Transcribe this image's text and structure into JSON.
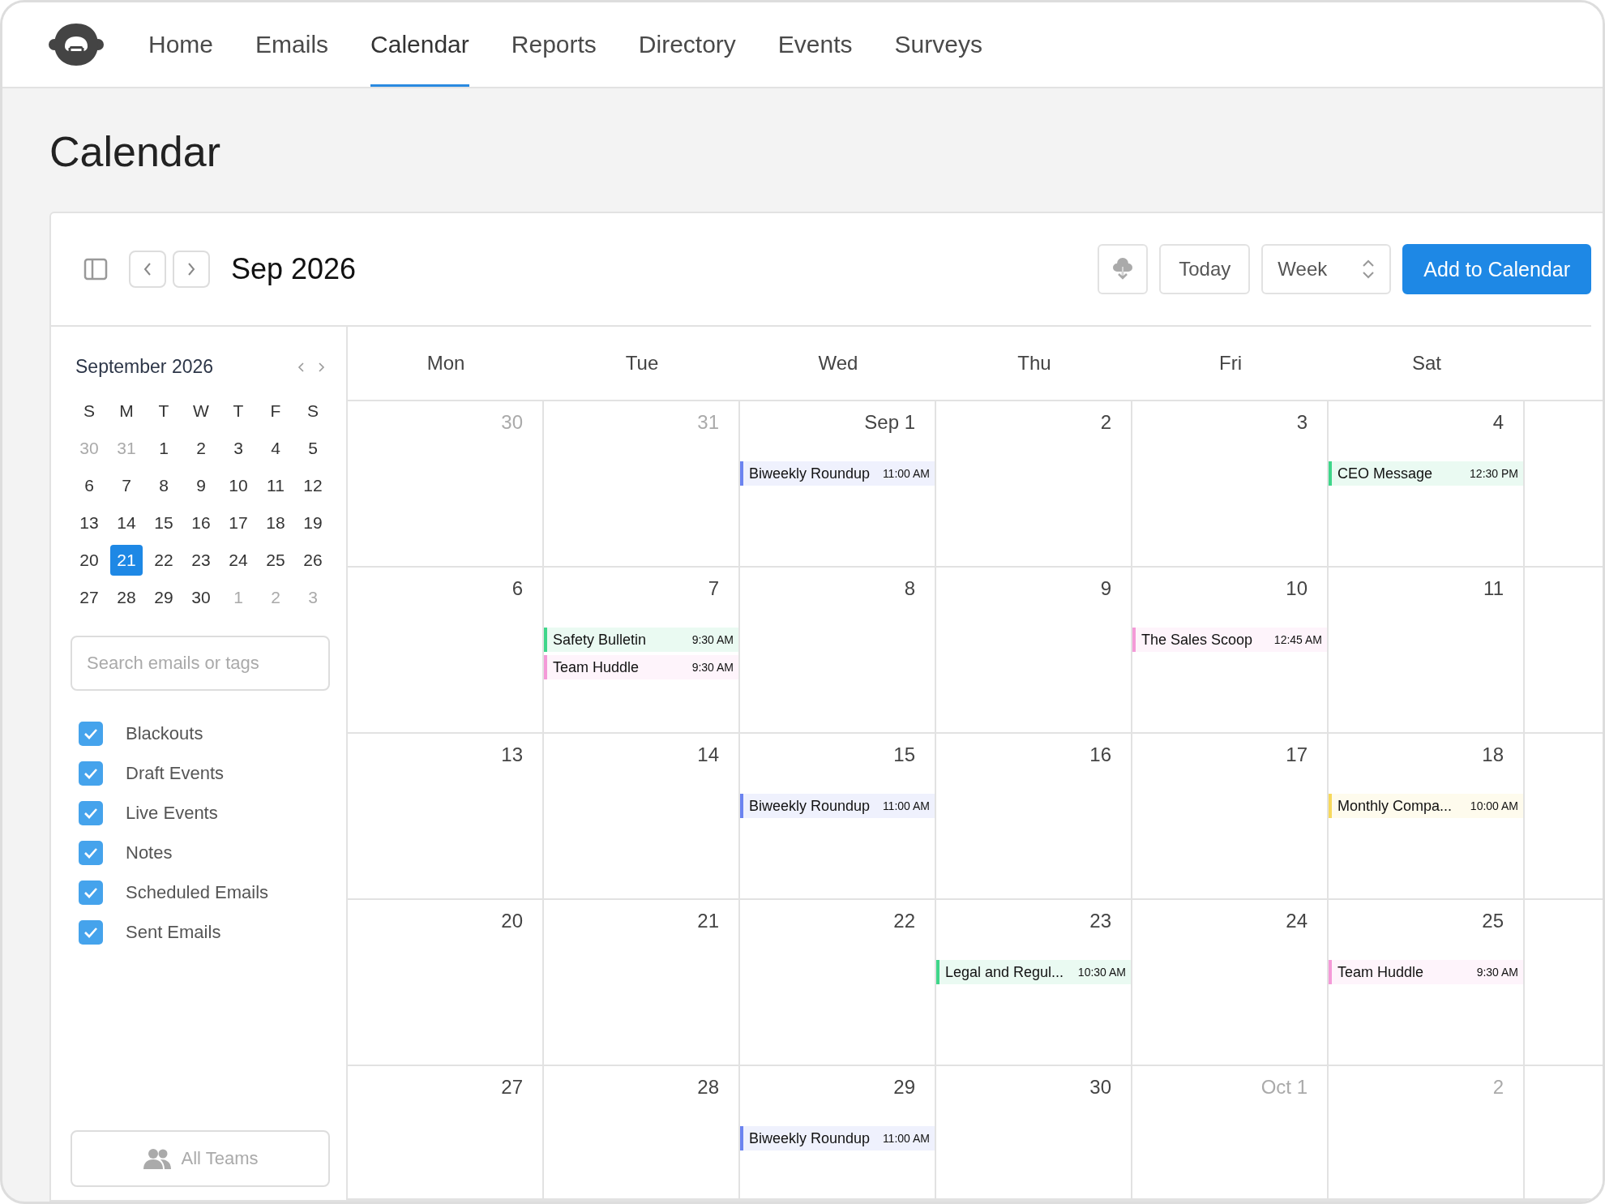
{
  "nav": {
    "items": [
      {
        "label": "Home",
        "selected": false
      },
      {
        "label": "Emails",
        "selected": false
      },
      {
        "label": "Calendar",
        "selected": true
      },
      {
        "label": "Reports",
        "selected": false
      },
      {
        "label": "Directory",
        "selected": false
      },
      {
        "label": "Events",
        "selected": false
      },
      {
        "label": "Surveys",
        "selected": false
      }
    ]
  },
  "page_title": "Calendar",
  "toolbar": {
    "period": "Sep 2026",
    "today_button": "Today",
    "view_select": "Week",
    "add_button": "Add to Calendar"
  },
  "mini_calendar": {
    "title": "September 2026",
    "weekdays": [
      "S",
      "M",
      "T",
      "W",
      "T",
      "F",
      "S"
    ],
    "weeks": [
      [
        {
          "label": "30",
          "muted": true,
          "selected": false
        },
        {
          "label": "31",
          "muted": true,
          "selected": false
        },
        {
          "label": "1",
          "muted": false,
          "selected": false
        },
        {
          "label": "2",
          "muted": false,
          "selected": false
        },
        {
          "label": "3",
          "muted": false,
          "selected": false
        },
        {
          "label": "4",
          "muted": false,
          "selected": false
        },
        {
          "label": "5",
          "muted": false,
          "selected": false
        }
      ],
      [
        {
          "label": "6",
          "muted": false,
          "selected": false
        },
        {
          "label": "7",
          "muted": false,
          "selected": false
        },
        {
          "label": "8",
          "muted": false,
          "selected": false
        },
        {
          "label": "9",
          "muted": false,
          "selected": false
        },
        {
          "label": "10",
          "muted": false,
          "selected": false
        },
        {
          "label": "11",
          "muted": false,
          "selected": false
        },
        {
          "label": "12",
          "muted": false,
          "selected": false
        }
      ],
      [
        {
          "label": "13",
          "muted": false,
          "selected": false
        },
        {
          "label": "14",
          "muted": false,
          "selected": false
        },
        {
          "label": "15",
          "muted": false,
          "selected": false
        },
        {
          "label": "16",
          "muted": false,
          "selected": false
        },
        {
          "label": "17",
          "muted": false,
          "selected": false
        },
        {
          "label": "18",
          "muted": false,
          "selected": false
        },
        {
          "label": "19",
          "muted": false,
          "selected": false
        }
      ],
      [
        {
          "label": "20",
          "muted": false,
          "selected": false
        },
        {
          "label": "21",
          "muted": false,
          "selected": true
        },
        {
          "label": "22",
          "muted": false,
          "selected": false
        },
        {
          "label": "23",
          "muted": false,
          "selected": false
        },
        {
          "label": "24",
          "muted": false,
          "selected": false
        },
        {
          "label": "25",
          "muted": false,
          "selected": false
        },
        {
          "label": "26",
          "muted": false,
          "selected": false
        }
      ],
      [
        {
          "label": "27",
          "muted": false,
          "selected": false
        },
        {
          "label": "28",
          "muted": false,
          "selected": false
        },
        {
          "label": "29",
          "muted": false,
          "selected": false
        },
        {
          "label": "30",
          "muted": false,
          "selected": false
        },
        {
          "label": "1",
          "muted": true,
          "selected": false
        },
        {
          "label": "2",
          "muted": true,
          "selected": false
        },
        {
          "label": "3",
          "muted": true,
          "selected": false
        }
      ]
    ]
  },
  "search": {
    "placeholder": "Search emails or tags"
  },
  "filters": [
    {
      "label": "Blackouts",
      "checked": true
    },
    {
      "label": "Draft Events",
      "checked": true
    },
    {
      "label": "Live Events",
      "checked": true
    },
    {
      "label": "Notes",
      "checked": true
    },
    {
      "label": "Scheduled Emails",
      "checked": true
    },
    {
      "label": "Sent Emails",
      "checked": true
    }
  ],
  "teams_button": "All Teams",
  "calendar": {
    "weekdays": [
      "Mon",
      "Tue",
      "Wed",
      "Thu",
      "Fri",
      "Sat"
    ],
    "weeks": [
      {
        "days": [
          {
            "label": "30",
            "muted": true
          },
          {
            "label": "31",
            "muted": true
          },
          {
            "label": "Sep 1",
            "muted": false,
            "events": [
              {
                "title": "Biweekly Roundup",
                "time": "11:00 AM",
                "color": "#6b83f0"
              }
            ]
          },
          {
            "label": "2",
            "muted": false
          },
          {
            "label": "3",
            "muted": false
          },
          {
            "label": "4",
            "muted": false,
            "events": [
              {
                "title": "CEO Message",
                "time": "12:30 PM",
                "color": "#3fd68a"
              }
            ]
          }
        ]
      },
      {
        "days": [
          {
            "label": "6",
            "muted": false
          },
          {
            "label": "7",
            "muted": false,
            "events": [
              {
                "title": "Safety Bulletin",
                "time": "9:30 AM",
                "color": "#3fd68a"
              },
              {
                "title": "Team Huddle",
                "time": "9:30 AM",
                "color": "#f49ad8"
              }
            ]
          },
          {
            "label": "8",
            "muted": false
          },
          {
            "label": "9",
            "muted": false
          },
          {
            "label": "10",
            "muted": false,
            "events": [
              {
                "title": "The Sales Scoop",
                "time": "12:45 AM",
                "color": "#f49ad8"
              }
            ]
          },
          {
            "label": "11",
            "muted": false
          }
        ]
      },
      {
        "days": [
          {
            "label": "13",
            "muted": false
          },
          {
            "label": "14",
            "muted": false
          },
          {
            "label": "15",
            "muted": false,
            "events": [
              {
                "title": "Biweekly Roundup",
                "time": "11:00 AM",
                "color": "#6b83f0"
              }
            ]
          },
          {
            "label": "16",
            "muted": false
          },
          {
            "label": "17",
            "muted": false
          },
          {
            "label": "18",
            "muted": false,
            "events": [
              {
                "title": "Monthly Compa...",
                "time": "10:00 AM",
                "color": "#f7d95c"
              }
            ]
          }
        ]
      },
      {
        "days": [
          {
            "label": "20",
            "muted": false
          },
          {
            "label": "21",
            "muted": false
          },
          {
            "label": "22",
            "muted": false
          },
          {
            "label": "23",
            "muted": false,
            "events": [
              {
                "title": "Legal and Regul...",
                "time": "10:30 AM",
                "color": "#3fd68a"
              }
            ]
          },
          {
            "label": "24",
            "muted": false
          },
          {
            "label": "25",
            "muted": false,
            "events": [
              {
                "title": "Team Huddle",
                "time": "9:30 AM",
                "color": "#f49ad8"
              }
            ]
          }
        ]
      },
      {
        "days": [
          {
            "label": "27",
            "muted": false
          },
          {
            "label": "28",
            "muted": false
          },
          {
            "label": "29",
            "muted": false,
            "events": [
              {
                "title": "Biweekly Roundup",
                "time": "11:00 AM",
                "color": "#6b83f0"
              }
            ]
          },
          {
            "label": "30",
            "muted": false
          },
          {
            "label": "Oct 1",
            "muted": true
          },
          {
            "label": "2",
            "muted": true
          }
        ]
      }
    ]
  }
}
